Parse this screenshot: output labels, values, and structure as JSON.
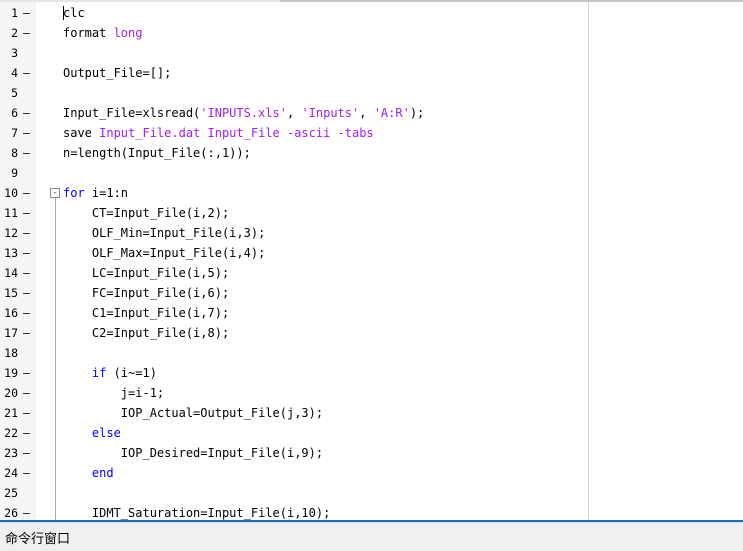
{
  "editor": {
    "lines": [
      {
        "n": "1",
        "dash": "–",
        "tokens": [
          {
            "t": "clc",
            "c": "plain"
          }
        ]
      },
      {
        "n": "2",
        "dash": "–",
        "tokens": [
          {
            "t": "format ",
            "c": "plain"
          },
          {
            "t": "long",
            "c": "str"
          }
        ]
      },
      {
        "n": "3",
        "dash": "",
        "tokens": []
      },
      {
        "n": "4",
        "dash": "–",
        "tokens": [
          {
            "t": "Output_File=[];",
            "c": "plain"
          }
        ]
      },
      {
        "n": "5",
        "dash": "",
        "tokens": []
      },
      {
        "n": "6",
        "dash": "–",
        "tokens": [
          {
            "t": "Input_File=xlsread(",
            "c": "plain"
          },
          {
            "t": "'INPUTS.xls'",
            "c": "str"
          },
          {
            "t": ", ",
            "c": "plain"
          },
          {
            "t": "'Inputs'",
            "c": "str"
          },
          {
            "t": ", ",
            "c": "plain"
          },
          {
            "t": "'A:R'",
            "c": "str"
          },
          {
            "t": ");",
            "c": "plain"
          }
        ]
      },
      {
        "n": "7",
        "dash": "–",
        "tokens": [
          {
            "t": "save ",
            "c": "plain"
          },
          {
            "t": "Input_File.dat Input_File -ascii -tabs",
            "c": "str"
          }
        ]
      },
      {
        "n": "8",
        "dash": "–",
        "tokens": [
          {
            "t": "n=length(Input_File(:,1));",
            "c": "plain"
          }
        ]
      },
      {
        "n": "9",
        "dash": "",
        "tokens": []
      },
      {
        "n": "10",
        "dash": "–",
        "fold": "-",
        "tokens": [
          {
            "t": "for",
            "c": "kw"
          },
          {
            "t": " i=1:n",
            "c": "plain"
          }
        ]
      },
      {
        "n": "11",
        "dash": "–",
        "tokens": [
          {
            "t": "    CT=Input_File(i,2);",
            "c": "plain"
          }
        ]
      },
      {
        "n": "12",
        "dash": "–",
        "tokens": [
          {
            "t": "    OLF_Min=Input_File(i,3);",
            "c": "plain"
          }
        ]
      },
      {
        "n": "13",
        "dash": "–",
        "tokens": [
          {
            "t": "    OLF_Max=Input_File(i,4);",
            "c": "plain"
          }
        ]
      },
      {
        "n": "14",
        "dash": "–",
        "tokens": [
          {
            "t": "    LC=Input_File(i,5);",
            "c": "plain"
          }
        ]
      },
      {
        "n": "15",
        "dash": "–",
        "tokens": [
          {
            "t": "    FC=Input_File(i,6);",
            "c": "plain"
          }
        ]
      },
      {
        "n": "16",
        "dash": "–",
        "tokens": [
          {
            "t": "    C1=Input_File(i,7);",
            "c": "plain"
          }
        ]
      },
      {
        "n": "17",
        "dash": "–",
        "tokens": [
          {
            "t": "    C2=Input_File(i,8);",
            "c": "plain"
          }
        ]
      },
      {
        "n": "18",
        "dash": "",
        "tokens": []
      },
      {
        "n": "19",
        "dash": "–",
        "tokens": [
          {
            "t": "    ",
            "c": "plain"
          },
          {
            "t": "if",
            "c": "kw"
          },
          {
            "t": " (i~=1)",
            "c": "plain"
          }
        ]
      },
      {
        "n": "20",
        "dash": "–",
        "tokens": [
          {
            "t": "        j=i-1;",
            "c": "plain"
          }
        ]
      },
      {
        "n": "21",
        "dash": "–",
        "tokens": [
          {
            "t": "        IOP_Actual=Output_File(j,3);",
            "c": "plain"
          }
        ]
      },
      {
        "n": "22",
        "dash": "–",
        "tokens": [
          {
            "t": "    ",
            "c": "plain"
          },
          {
            "t": "else",
            "c": "kw"
          }
        ]
      },
      {
        "n": "23",
        "dash": "–",
        "tokens": [
          {
            "t": "        IOP_Desired=Input_File(i,9);",
            "c": "plain"
          }
        ]
      },
      {
        "n": "24",
        "dash": "–",
        "tokens": [
          {
            "t": "    ",
            "c": "plain"
          },
          {
            "t": "end",
            "c": "kw"
          }
        ]
      },
      {
        "n": "25",
        "dash": "",
        "tokens": []
      },
      {
        "n": "26",
        "dash": "–",
        "tokens": [
          {
            "t": "    IDMT_Saturation=Input_File(i,10);",
            "c": "plain"
          }
        ]
      }
    ]
  },
  "command_window": {
    "title": "命令行窗口"
  },
  "colors": {
    "keyword": "#0000ff",
    "string": "#a020f0",
    "accent": "#1c6fb7"
  }
}
